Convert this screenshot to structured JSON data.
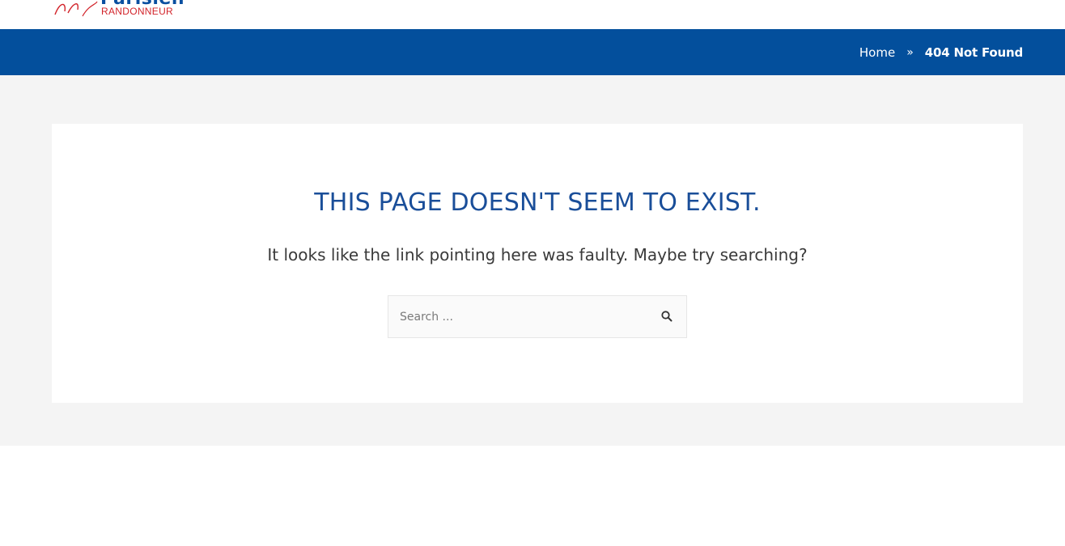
{
  "header": {
    "logo": {
      "title": "Parisien",
      "subtitle": "RANDONNEUR"
    }
  },
  "breadcrumb": {
    "home": "Home",
    "separator": "»",
    "current": "404 Not Found"
  },
  "error": {
    "title": "THIS PAGE DOESN'T SEEM TO EXIST.",
    "message": "It looks like the link pointing here was faulty. Maybe try searching?"
  },
  "search": {
    "placeholder": "Search ...",
    "value": "",
    "icon": "search-icon"
  },
  "colors": {
    "brand_blue": "#034f9c",
    "title_blue": "#1a4e99",
    "logo_red": "#d2232a",
    "content_bg": "#f4f4f4"
  }
}
